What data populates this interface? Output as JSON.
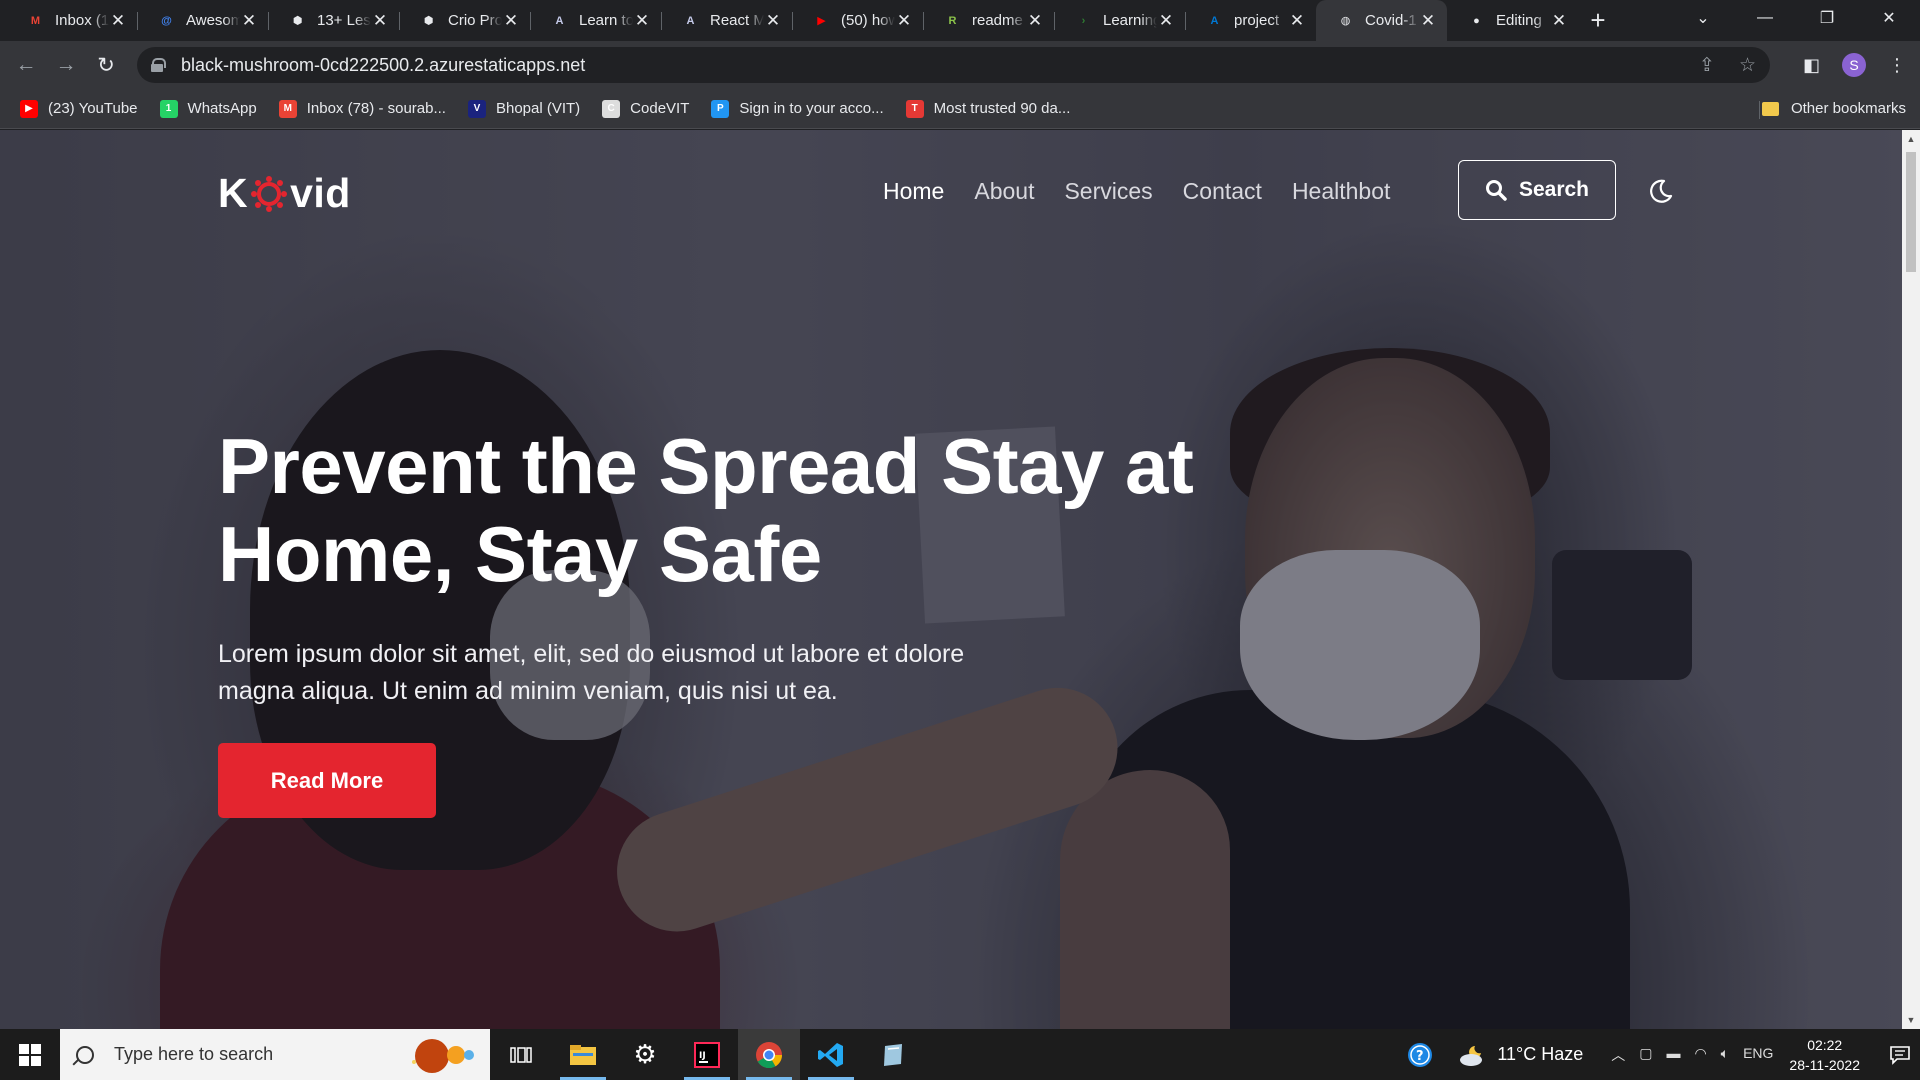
{
  "browser": {
    "tabs": [
      {
        "title": "Inbox (1",
        "favicon": "gmail-icon",
        "color": "#ea4335",
        "glyph": "M"
      },
      {
        "title": "Awesome",
        "favicon": "at-icon",
        "color": "#4285f4",
        "glyph": "@"
      },
      {
        "title": "13+ Les",
        "favicon": "shield-icon",
        "color": "#e8eaed",
        "glyph": "⬢"
      },
      {
        "title": "Crio Pro",
        "favicon": "shield-icon",
        "color": "#e8eaed",
        "glyph": "⬢"
      },
      {
        "title": "Learn to",
        "favicon": "angular-icon",
        "color": "#c5cae9",
        "glyph": "A"
      },
      {
        "title": "React M",
        "favicon": "angular-icon",
        "color": "#c5cae9",
        "glyph": "A"
      },
      {
        "title": "(50) how",
        "favicon": "youtube-icon",
        "color": "#ff0000",
        "glyph": "▶"
      },
      {
        "title": "readme",
        "favicon": "readme-icon",
        "color": "#8bc34a",
        "glyph": "R"
      },
      {
        "title": "Learning",
        "favicon": "terminal-icon",
        "color": "#2e7d32",
        "glyph": "›"
      },
      {
        "title": "project",
        "favicon": "azure-icon",
        "color": "#0078d4",
        "glyph": "A"
      },
      {
        "title": "Covid-1",
        "favicon": "globe-icon",
        "color": "#e8eaed",
        "glyph": "◍",
        "active": true
      },
      {
        "title": "Editing",
        "favicon": "github-icon",
        "color": "#e8eaed",
        "glyph": "●"
      }
    ],
    "new_tab_symbol": "+",
    "url": "black-mushroom-0cd222500.2.azurestaticapps.net",
    "profile_initial": "S",
    "bookmarks": [
      {
        "label": "(23) YouTube",
        "icon": "youtube-icon",
        "color": "#ff0000",
        "glyph": "▶"
      },
      {
        "label": "WhatsApp",
        "icon": "whatsapp-icon",
        "color": "#25d366",
        "glyph": "1"
      },
      {
        "label": "Inbox (78) - sourab...",
        "icon": "gmail-icon",
        "color": "#ea4335",
        "glyph": "M"
      },
      {
        "label": "Bhopal (VIT)",
        "icon": "vit-icon",
        "color": "#1a237e",
        "glyph": "V"
      },
      {
        "label": "CodeVIT",
        "icon": "codevit-icon",
        "color": "#dddddd",
        "glyph": "C"
      },
      {
        "label": "Sign in to your acco...",
        "icon": "microsoft-icon",
        "color": "#2196f3",
        "glyph": "P"
      },
      {
        "label": "Most trusted 90 da...",
        "icon": "tuf-icon",
        "color": "#e53935",
        "glyph": "T"
      }
    ],
    "other_bookmarks": "Other bookmarks"
  },
  "site": {
    "logo_prefix": "K",
    "logo_suffix": "vid",
    "nav": [
      "Home",
      "About",
      "Services",
      "Contact",
      "Healthbot"
    ],
    "search_label": "Search",
    "hero_title": "Prevent the Spread Stay at Home, Stay Safe",
    "hero_text": "Lorem ipsum dolor sit amet, elit, sed do eiusmod ut labore et dolore magna aliqua. Ut enim ad minim veniam, quis nisi ut ea.",
    "cta": "Read More",
    "accent": "#e4252f"
  },
  "taskbar": {
    "search_placeholder": "Type here to search",
    "weather": "11°C  Haze",
    "lang": "ENG",
    "time": "02:22",
    "date": "28-11-2022"
  }
}
